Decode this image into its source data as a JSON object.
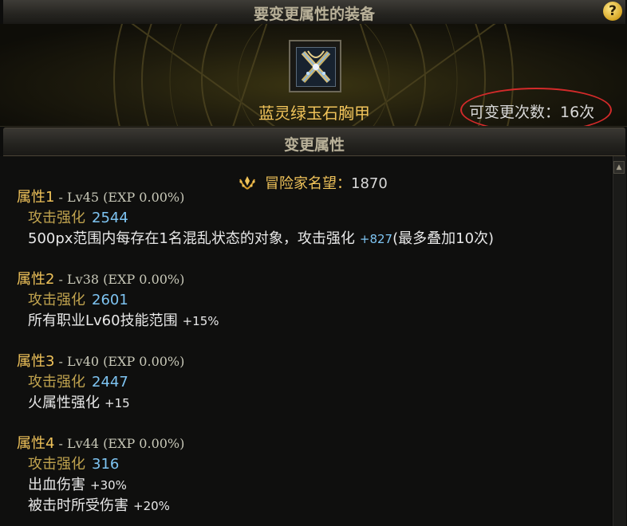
{
  "header": {
    "title": "要变更属性的装备",
    "help_label": "?"
  },
  "equipment": {
    "name": "蓝灵绿玉石胸甲",
    "icon": "armor-icon",
    "change_count_label": "可变更次数：16次"
  },
  "subheader": {
    "title": "变更属性"
  },
  "reputation": {
    "label": "冒险家名望：",
    "value": "1870",
    "icon": "laurel-icon"
  },
  "attributes": [
    {
      "title": "属性1",
      "level": " - Lv45 (EXP 0.00%)",
      "attack_label": "攻击强化",
      "attack_value": "2544",
      "effects": [
        {
          "text": "500px范围内每存在1名混乱状态的对象，攻击强化",
          "value": "+827",
          "note": "(最多叠加10次)"
        }
      ]
    },
    {
      "title": "属性2",
      "level": " - Lv38 (EXP 0.00%)",
      "attack_label": "攻击强化",
      "attack_value": "2601",
      "effects": [
        {
          "text": "所有职业Lv60技能范围",
          "value": "+15%"
        }
      ]
    },
    {
      "title": "属性3",
      "level": " - Lv40 (EXP 0.00%)",
      "attack_label": "攻击强化",
      "attack_value": "2447",
      "effects": [
        {
          "text": "火属性强化",
          "value": "+15"
        }
      ]
    },
    {
      "title": "属性4",
      "level": " - Lv44 (EXP 0.00%)",
      "attack_label": "攻击强化",
      "attack_value": "316",
      "effects": [
        {
          "text": "出血伤害",
          "value": "+30%"
        },
        {
          "text": "被击时所受伤害",
          "value": "+20%"
        }
      ]
    }
  ],
  "colors": {
    "gold_text": "#f0c35a",
    "value_blue": "#7ec4f2",
    "highlight_red": "#d32a2a"
  }
}
